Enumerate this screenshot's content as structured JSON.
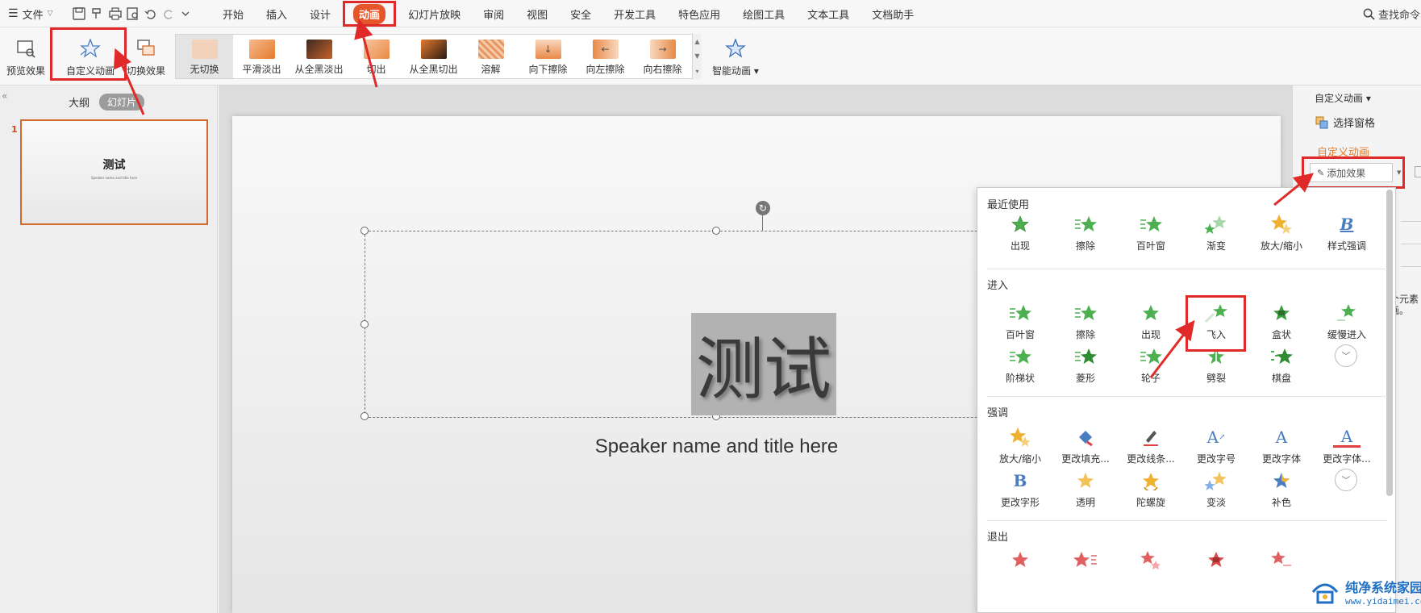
{
  "menubar": {
    "file_label": "文件",
    "tabs": [
      {
        "label": "开始"
      },
      {
        "label": "插入"
      },
      {
        "label": "设计"
      },
      {
        "label": "动画"
      },
      {
        "label": "幻灯片放映"
      },
      {
        "label": "审阅"
      },
      {
        "label": "视图"
      },
      {
        "label": "安全"
      },
      {
        "label": "开发工具"
      },
      {
        "label": "特色应用"
      },
      {
        "label": "绘图工具"
      },
      {
        "label": "文本工具"
      },
      {
        "label": "文档助手"
      }
    ],
    "active_tab": "动画",
    "search_label": "查找命令、"
  },
  "ribbon": {
    "preview_label": "预览效果",
    "custom_animation_label": "自定义动画",
    "switch_effect_label": "切换效果",
    "transitions": [
      {
        "label": "无切换"
      },
      {
        "label": "平滑淡出"
      },
      {
        "label": "从全黑淡出"
      },
      {
        "label": "切出"
      },
      {
        "label": "从全黑切出"
      },
      {
        "label": "溶解"
      },
      {
        "label": "向下擦除"
      },
      {
        "label": "向左擦除"
      },
      {
        "label": "向右擦除"
      }
    ],
    "smart_animation_label": "智能动画"
  },
  "left_panel": {
    "outline_tab": "大纲",
    "slides_tab": "幻灯片",
    "slide_number": "1",
    "thumb_title": "测试",
    "thumb_subtitle": "Speaker name and title here"
  },
  "slide": {
    "title": "测试",
    "subtitle": "Speaker name and title here"
  },
  "right_panel": {
    "title": "自定义动画",
    "select_pane": "选择窗格",
    "heading": "自定义动画",
    "add_effect": "添加效果",
    "hint": "个元素\n画。"
  },
  "effects_menu": {
    "sections": [
      {
        "label": "最近使用",
        "items": [
          {
            "label": "出现",
            "icon": "star-icon"
          },
          {
            "label": "擦除",
            "icon": "star-lines-icon"
          },
          {
            "label": "百叶窗",
            "icon": "star-lines-icon"
          },
          {
            "label": "渐变",
            "icon": "star-fade-icon"
          },
          {
            "label": "放大/缩小",
            "icon": "star-gold-icon"
          },
          {
            "label": "样式强调",
            "icon": "letter-b-icon"
          }
        ]
      },
      {
        "label": "进入",
        "items": [
          {
            "label": "百叶窗",
            "icon": "star-lines-icon"
          },
          {
            "label": "擦除",
            "icon": "star-lines-icon"
          },
          {
            "label": "出现",
            "icon": "star-icon"
          },
          {
            "label": "飞入",
            "icon": "star-fly-icon"
          },
          {
            "label": "盒状",
            "icon": "star-box-icon"
          },
          {
            "label": "缓慢进入",
            "icon": "star-fade-icon"
          },
          {
            "label": "阶梯状",
            "icon": "star-lines-icon"
          },
          {
            "label": "菱形",
            "icon": "star-lines-icon"
          },
          {
            "label": "轮子",
            "icon": "star-lines-icon"
          },
          {
            "label": "劈裂",
            "icon": "star-split-icon"
          },
          {
            "label": "棋盘",
            "icon": "star-check-icon"
          }
        ]
      },
      {
        "label": "强调",
        "items": [
          {
            "label": "放大/缩小",
            "icon": "star-gold-icon"
          },
          {
            "label": "更改填充...",
            "icon": "paint-bucket-icon"
          },
          {
            "label": "更改线条...",
            "icon": "pen-icon"
          },
          {
            "label": "更改字号",
            "icon": "font-size-icon"
          },
          {
            "label": "更改字体",
            "icon": "letter-a-icon"
          },
          {
            "label": "更改字体...",
            "icon": "letter-a-underline-icon"
          },
          {
            "label": "更改字形",
            "icon": "letter-b-icon"
          },
          {
            "label": "透明",
            "icon": "star-gold-icon"
          },
          {
            "label": "陀螺旋",
            "icon": "star-spin-icon"
          },
          {
            "label": "变淡",
            "icon": "star-gold-fade-icon"
          },
          {
            "label": "补色",
            "icon": "star-blue-icon"
          }
        ]
      },
      {
        "label": "退出",
        "items": [
          {
            "label": "",
            "icon": "star-red-icon"
          },
          {
            "label": "",
            "icon": "star-red-icon"
          },
          {
            "label": "",
            "icon": "star-red-icon"
          },
          {
            "label": "",
            "icon": "star-red-icon"
          },
          {
            "label": "",
            "icon": "star-red-icon"
          }
        ]
      }
    ]
  },
  "watermark": {
    "name": "纯净系统家园",
    "url": "www.yidaimei.com"
  },
  "colors": {
    "accent": "#e5562a",
    "callout": "#e02a2a",
    "entrance_star": "#4caf50",
    "emphasis_star": "#f0b030",
    "exit_star": "#e06060"
  }
}
